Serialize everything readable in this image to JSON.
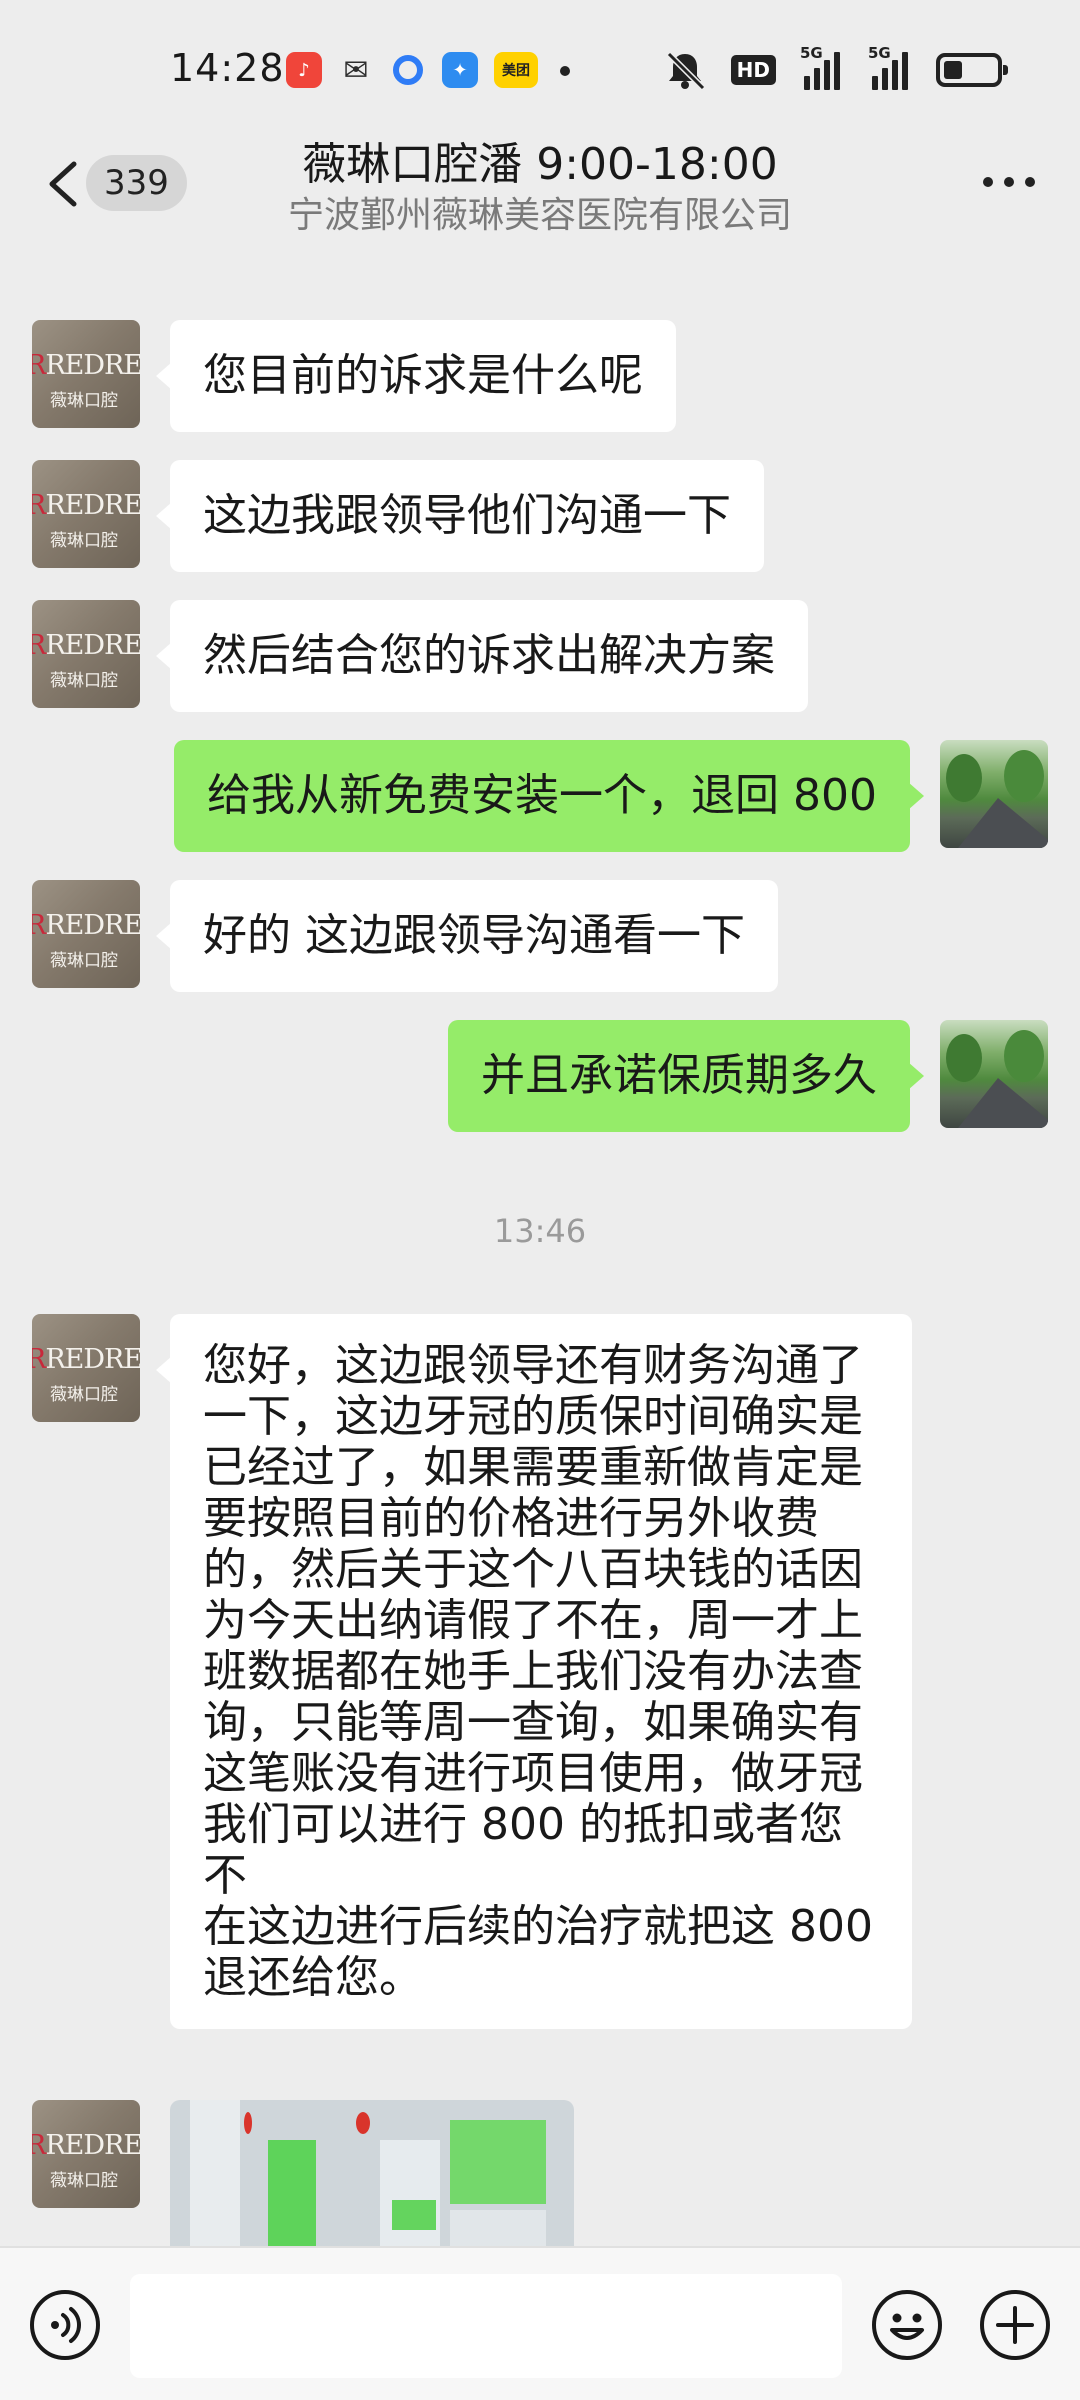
{
  "status_bar": {
    "time": "14:28",
    "apps": [
      {
        "name": "music-app-icon",
        "color": "#f0453a",
        "glyph": "♪"
      },
      {
        "name": "wechat-app-icon",
        "color": "#2d2d2d",
        "glyph": "✉"
      },
      {
        "name": "circle-app-icon",
        "color": "#2f7cf6",
        "glyph": "◯"
      },
      {
        "name": "feather-app-icon",
        "color": "#2e8cf0",
        "glyph": "✦"
      },
      {
        "name": "meituan-app-icon",
        "color": "#ffd100",
        "glyph": "美团"
      }
    ],
    "hd_label": "HD",
    "signal_labels": [
      "5G",
      "5G"
    ],
    "battery_level": 0.35
  },
  "header": {
    "unread_count": "339",
    "title": "薇琳口腔潘 9:00-18:00",
    "subtitle": "宁波鄞州薇琳美容医院有限公司"
  },
  "avatar_brand": {
    "top": "REDREAM",
    "bottom": "薇琳口腔"
  },
  "messages": [
    {
      "from": "them",
      "text": "您目前的诉求是什么呢"
    },
    {
      "from": "them",
      "text": "这边我跟领导他们沟通一下"
    },
    {
      "from": "them",
      "text": "然后结合您的诉求出解决方案"
    },
    {
      "from": "me",
      "text": "给我从新免费安装一个，退回 800"
    },
    {
      "from": "them",
      "text": "好的 这边跟领导沟通看一下"
    },
    {
      "from": "me",
      "text": "并且承诺保质期多久"
    },
    {
      "timestamp": "13:46"
    },
    {
      "from": "them",
      "text": "您好，这边跟领导还有财务沟通了\n一下，这边牙冠的质保时间确实是\n已经过了，如果需要重新做肯定是\n要按照目前的价格进行另外收费\n的，然后关于这个八百块钱的话因\n为今天出纳请假了不在，周一才上\n班数据都在她手上我们没有办法查\n询，只能等周一查询，如果确实有\n这笔账没有进行项目使用，做牙冠\n我们可以进行 800 的抵扣或者您不\n在这边进行后续的治疗就把这 800\n退还给您。"
    },
    {
      "from": "them",
      "type": "image",
      "image": "chat-screenshot-image"
    }
  ],
  "input": {
    "value": ""
  }
}
